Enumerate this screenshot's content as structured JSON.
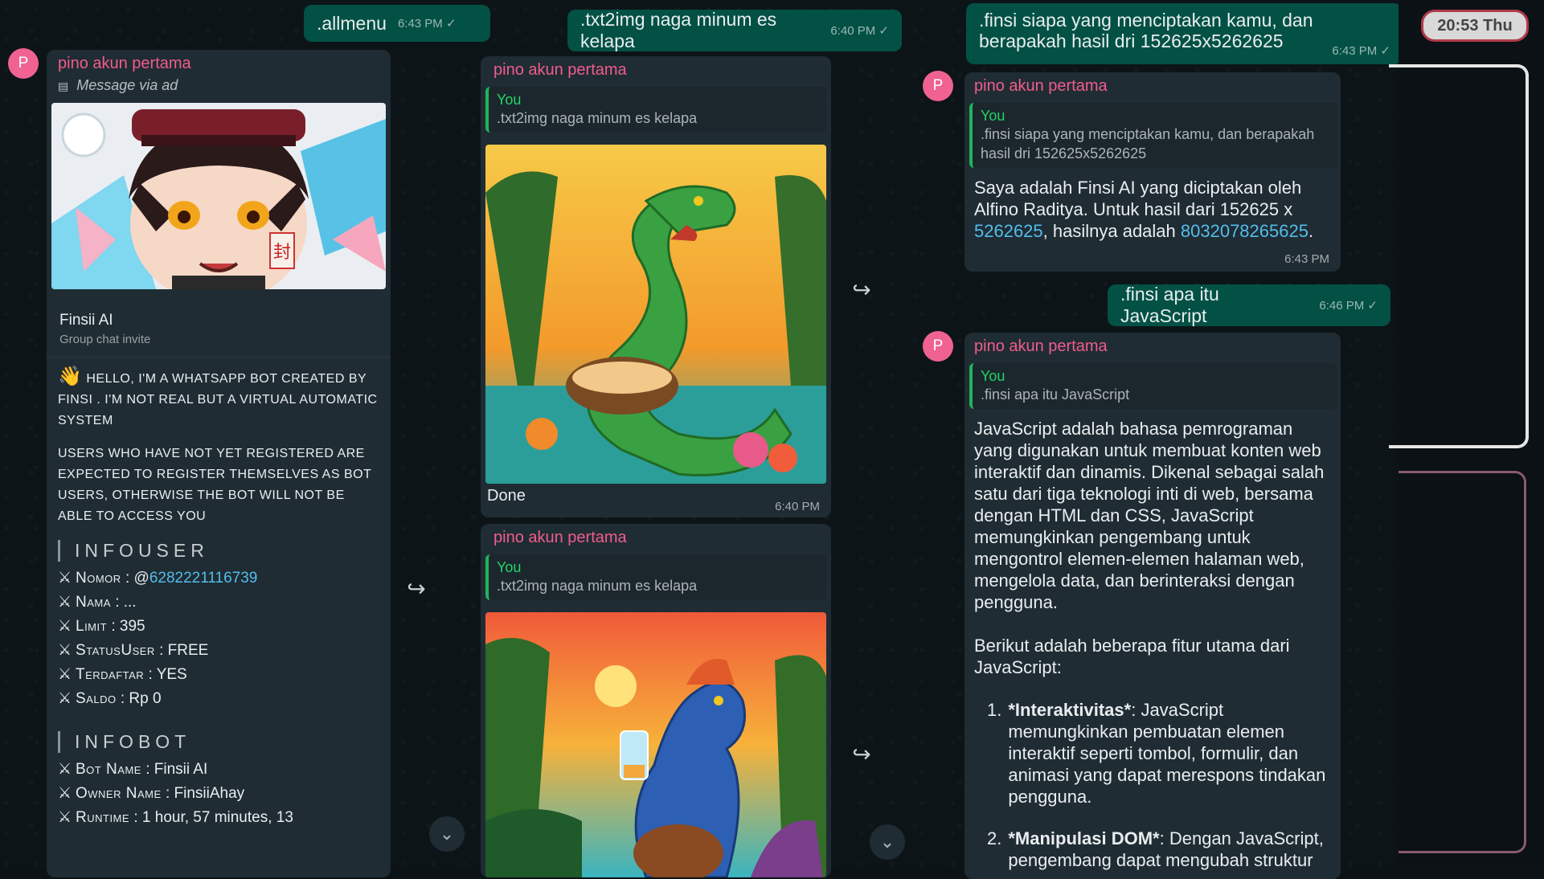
{
  "top_right": {
    "time_label": "20:53 Thu"
  },
  "column1": {
    "out_msg": {
      "text": ".allmenu",
      "time": "6:43 PM"
    },
    "sender": "pino akun pertama",
    "avatar_letter": "P",
    "via": "Message via ad",
    "invite": {
      "title": "Finsii AI",
      "subtitle": "Group chat invite"
    },
    "hello": "HELLO, I'M A WHATSAPP BOT CREATED BY FINSI . I'M NOT REAL BUT A VIRTUAL AUTOMATIC SYSTEM",
    "hello_emoji": "👋",
    "register": "USERS WHO HAVE NOT YET REGISTERED ARE EXPECTED TO REGISTER THEMSELVES AS BOT USERS, OTHERWISE THE BOT WILL NOT BE ABLE TO ACCESS YOU",
    "infouser": {
      "heading": "INFOUSER",
      "rows": [
        {
          "key": "Nomor",
          "value": "@",
          "link": "6282221116739"
        },
        {
          "key": "Nama",
          "value": ": ..."
        },
        {
          "key": "Limit",
          "value": ": 395"
        },
        {
          "key": "StatusUser",
          "value": ": FREE"
        },
        {
          "key": "Terdaftar",
          "value": ": YES"
        },
        {
          "key": "Saldo",
          "value": ": Rp 0"
        }
      ]
    },
    "infobot": {
      "heading": "INFOBOT",
      "rows": [
        {
          "key": "Bot Name",
          "value": ": Finsii AI"
        },
        {
          "key": "Owner Name",
          "value": ": FinsiiAhay"
        },
        {
          "key": "Runtime",
          "value": ": 1 hour, 57 minutes, 13"
        }
      ]
    }
  },
  "column2": {
    "out_msg": {
      "text": ".txt2img naga minum es kelapa",
      "time": "6:40 PM"
    },
    "msg1": {
      "sender": "pino akun pertama",
      "quote_who": "You",
      "quote_text": ".txt2img naga minum es kelapa",
      "caption": "Done",
      "time": "6:40 PM"
    },
    "msg2": {
      "sender": "pino akun pertama",
      "quote_who": "You",
      "quote_text": ".txt2img naga minum es kelapa"
    }
  },
  "column3": {
    "out_msg1": {
      "text": ".finsi siapa yang menciptakan kamu, dan berapakah hasil dri 152625x5262625",
      "time": "6:43 PM"
    },
    "reply1": {
      "sender": "pino akun pertama",
      "avatar_letter": "P",
      "quote_who": "You",
      "quote_text": ".finsi siapa yang menciptakan kamu, dan berapakah hasil dri 152625x5262625",
      "body_pre": "Saya adalah Finsi AI yang diciptakan oleh Alfino Raditya. Untuk hasil dari 152625 x ",
      "link1": "5262625",
      "body_mid": ", hasilnya adalah ",
      "link2": "8032078265625",
      "body_post": ".",
      "time": "6:43 PM"
    },
    "out_msg2": {
      "text": ".finsi apa itu JavaScript",
      "time": "6:46 PM"
    },
    "reply2": {
      "sender": "pino akun pertama",
      "avatar_letter": "P",
      "quote_who": "You",
      "quote_text": ".finsi apa itu JavaScript",
      "para1": "JavaScript adalah bahasa pemrograman yang digunakan untuk membuat konten web interaktif dan dinamis. Dikenal sebagai salah satu dari tiga teknologi inti di web, bersama dengan HTML dan CSS, JavaScript memungkinkan pengembang untuk mengontrol elemen-elemen halaman web, mengelola data, dan berinteraksi dengan pengguna.",
      "para2": "Berikut adalah beberapa fitur utama dari JavaScript:",
      "item1_num": "1.",
      "item1_bold": "*Interaktivitas*",
      "item1_text": ": JavaScript memungkinkan pembuatan elemen interaktif seperti tombol, formulir, dan animasi yang dapat merespons tindakan pengguna.",
      "item2_num": "2.",
      "item2_bold": "*Manipulasi DOM*",
      "item2_text": ": Dengan JavaScript, pengembang dapat mengubah struktur"
    }
  },
  "colors": {
    "accent_green": "#025144",
    "sender_pink": "#f15c8d",
    "link_blue": "#53bdeb",
    "quote_green": "#25d366"
  }
}
